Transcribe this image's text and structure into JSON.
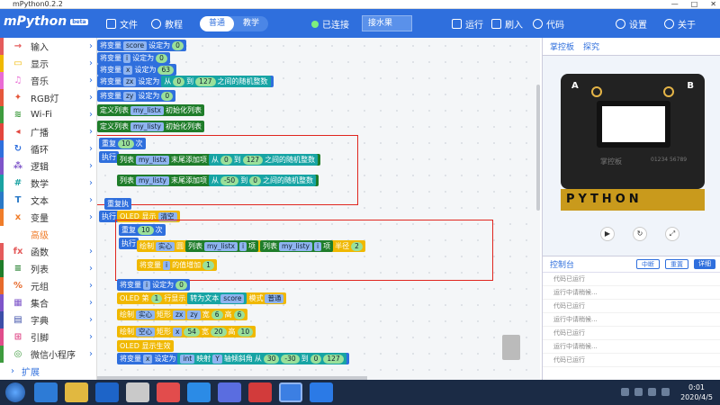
{
  "window": {
    "title": "mPython0.2.2",
    "min": "—",
    "max": "□",
    "close": "✕"
  },
  "toolbar": {
    "logo": "mPython",
    "logo_badge": "beta",
    "file": "文件",
    "tutorial": "教程",
    "mode_normal": "普通",
    "mode_teach": "教学",
    "status": "已连接",
    "serial": "接水果",
    "run": "运行",
    "flash": "刷入",
    "code": "代码",
    "settings": "设置",
    "about": "关于"
  },
  "categories": [
    {
      "label": "输入",
      "color": "#e45b5b",
      "icon": "→"
    },
    {
      "label": "显示",
      "color": "#f0b800",
      "icon": "▭"
    },
    {
      "label": "音乐",
      "color": "#e96bd4",
      "icon": "♫"
    },
    {
      "label": "RGB灯",
      "color": "#e5573b",
      "icon": "✦"
    },
    {
      "label": "Wi-Fi",
      "color": "#3e9b3e",
      "icon": "≋"
    },
    {
      "label": "广播",
      "color": "#e2463e",
      "icon": "◂"
    },
    {
      "label": "循环",
      "color": "#2f6fdd",
      "icon": "↻"
    },
    {
      "label": "逻辑",
      "color": "#7e55c9",
      "icon": "⁂"
    },
    {
      "label": "数学",
      "color": "#1aa2a2",
      "icon": "#"
    },
    {
      "label": "文本",
      "color": "#2a79c7",
      "icon": "T"
    },
    {
      "label": "变量",
      "color": "#f07d2a",
      "icon": "x"
    },
    {
      "label": "高级",
      "color": "#f07d2a",
      "icon": "",
      "highlight": true
    },
    {
      "label": "函数",
      "color": "#e45b5b",
      "icon": "fx"
    },
    {
      "label": "列表",
      "color": "#1f7d2a",
      "icon": "≡"
    },
    {
      "label": "元组",
      "color": "#e66a2c",
      "icon": "%"
    },
    {
      "label": "集合",
      "color": "#7e55c9",
      "icon": "▦"
    },
    {
      "label": "字典",
      "color": "#3c4ea8",
      "icon": "▤"
    },
    {
      "label": "引脚",
      "color": "#e04d8b",
      "icon": "⊞"
    },
    {
      "label": "微信小程序",
      "color": "#3e9b3e",
      "icon": "◎"
    },
    {
      "label": "扩展",
      "color": "#2f6fdd",
      "icon": "›",
      "expand": true
    }
  ],
  "blocks": {
    "set_var": "将变量",
    "set_to": "设定为",
    "var_score": "score",
    "var_i": "i",
    "var_x": "x",
    "var_zx": "zx",
    "var_zy": "zy",
    "val0": "0",
    "val63": "63",
    "from": "从",
    "to": "到",
    "between_rand": "之间的随机整数",
    "v127": "127",
    "def_list": "定义列表",
    "my_listx": "my_listx",
    "my_listy": "my_listy",
    "init_list": "初始化列表",
    "repeat": "重复",
    "times": "次",
    "v10": "10",
    "do": "执行",
    "list": "列表",
    "append_end": "末尾添加项",
    "vm50": "-50",
    "repeat_end": "重复执",
    "oled_show": "OLED 显示",
    "clear": "清空",
    "draw": "绘制",
    "solid": "实心",
    "circle_at": "圆",
    "item": "项",
    "radius": "半径",
    "v2": "2",
    "var_i_inc": "的值增加",
    "v1": "1",
    "oled_row": "OLED 第",
    "row_show": "行显示",
    "to_text": "转为文本",
    "mode": "模式",
    "normal": "普通",
    "rect": "矩形",
    "hollow": "空心",
    "width": "宽",
    "height": "高",
    "v6": "6",
    "v54": "54",
    "v20": "20",
    "oled_effect": "OLED 显示生效",
    "int": "int",
    "map": "映射",
    "y_tilt": "Y",
    "tilt": "轴倾斜角",
    "v30": "30",
    "vm30": "-30",
    "var_y": "y"
  },
  "right_panel": {
    "tab_board": "掌控板",
    "tab_explore": "探究",
    "btn_a": "A",
    "btn_b": "B",
    "board_label": "掌控板",
    "board_serial": "01234 56789",
    "pins": "PYTHON",
    "console": "控制台",
    "console_btn1": "中断",
    "console_btn2": "重置",
    "console_btn3": "详细",
    "lines": [
      "代码已运行",
      "运行中请稍候...",
      "代码已运行",
      "运行中请稍候...",
      "代码已运行",
      "运行中请稍候...",
      "代码已运行"
    ]
  },
  "taskbar": {
    "time": "0:01",
    "date": "2020/4/5"
  }
}
